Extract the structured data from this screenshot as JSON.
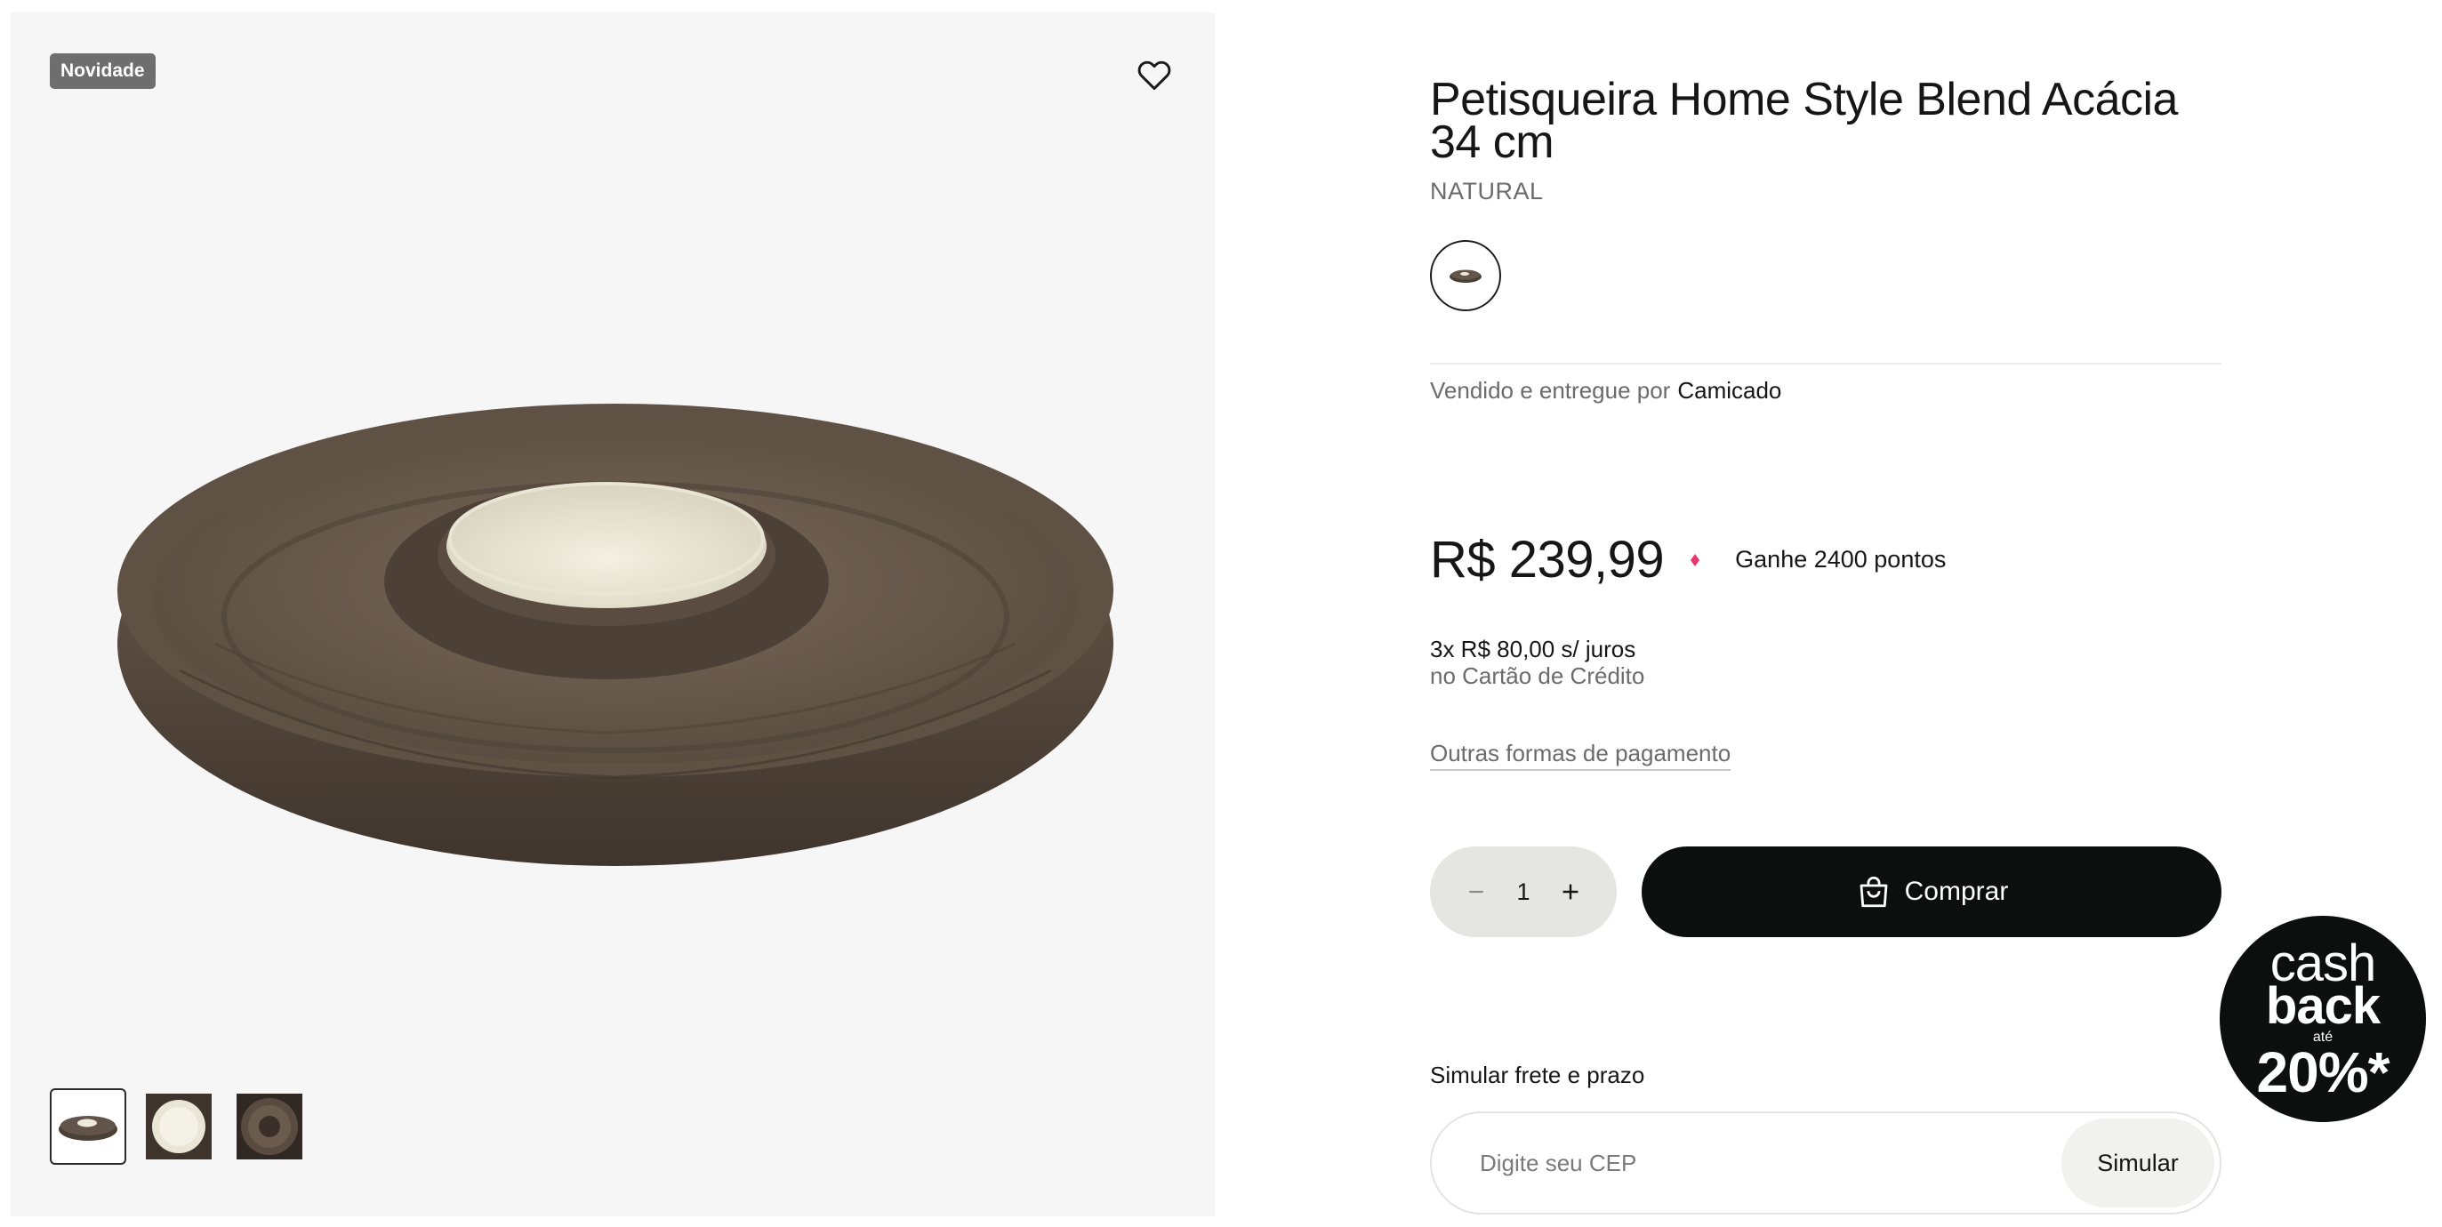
{
  "gallery": {
    "badge": "Novidade",
    "thumbnails": [
      "wooden-tray-front",
      "white-bowl-top",
      "wooden-tray-top"
    ]
  },
  "product": {
    "title": "Petisqueira Home Style Blend Acácia 34 cm",
    "variant": "NATURAL",
    "seller_prefix": "Vendido e entregue por",
    "seller_name": "Camicado",
    "price": "R$ 239,99",
    "points": "Ganhe 2400 pontos",
    "installments_main": "3x R$ 80,00 s/ juros",
    "installments_sub": "no Cartão de Crédito",
    "other_payments": "Outras formas de pagamento"
  },
  "purchase": {
    "quantity": "1",
    "buy_label": "Comprar"
  },
  "shipping": {
    "label": "Simular frete e prazo",
    "cep_placeholder": "Digite seu CEP",
    "simulate_label": "Simular"
  },
  "cashback": {
    "line1": "cash",
    "line2": "back",
    "line3": "até",
    "percent": "20%*"
  },
  "colors": {
    "accent_points": "#e8366e",
    "button_dark": "#0d0f0e",
    "qty_bg": "#e5e5e2"
  }
}
